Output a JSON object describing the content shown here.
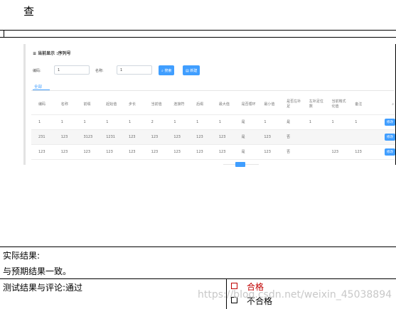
{
  "heading": "查",
  "panel": {
    "title": "≡ 当前显示 :序列号",
    "search": {
      "code_label": "编码:",
      "code_value": "1",
      "name_label": "名称:",
      "name_value": "1",
      "search_button": "搜索",
      "add_button": "新建"
    },
    "tab_all": "全部",
    "columns": [
      "编码",
      "名称",
      "前缀",
      "起始值",
      "步长",
      "当前值",
      "连接符",
      "后缀",
      "最大值",
      "是否循环",
      "最小值",
      "是否左补足",
      "左补足位数",
      "当前格式化值",
      "备注",
      ""
    ],
    "rows": [
      [
        "1",
        "1",
        "1",
        "1",
        "1",
        "2",
        "1",
        "1",
        "1",
        "是",
        "1",
        "是",
        "1",
        "1",
        "1",
        "修改"
      ],
      [
        "231",
        "123",
        "3123",
        "1231",
        "123",
        "123",
        "123",
        "123",
        "123",
        "是",
        "123",
        "否",
        "",
        "",
        "",
        "修改"
      ],
      [
        "123",
        "123",
        "123",
        "123",
        "123",
        "123",
        "123",
        "123",
        "123",
        "是",
        "123",
        "否",
        "",
        "123",
        "123",
        "修改"
      ]
    ],
    "page": "1"
  },
  "result": {
    "label": "实际结果:",
    "text": "与预期结果一致。"
  },
  "evaluation": {
    "label": "测试结果与评论:通过",
    "pass": "合格",
    "fail": "不合格"
  },
  "watermark": "https://blog.csdn.net/weixin_45038894",
  "colors": {
    "accent": "#409eff",
    "pass": "#c00000"
  }
}
